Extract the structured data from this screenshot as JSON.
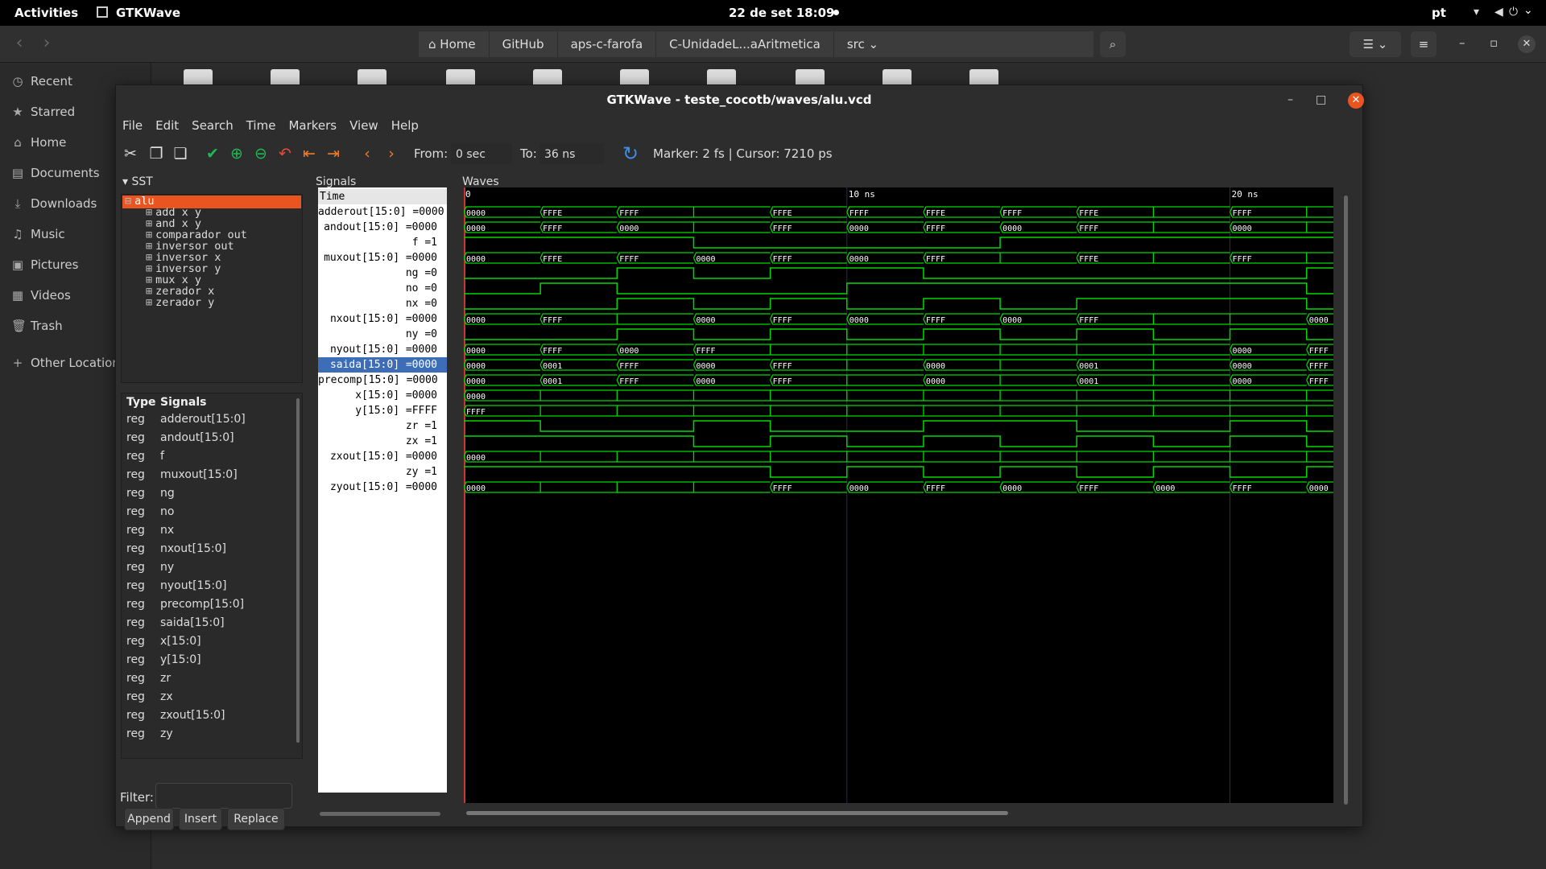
{
  "topbar": {
    "activities": "Activities",
    "app": "GTKWave",
    "clock": "22 de set  18:09",
    "lang": "pt"
  },
  "files": {
    "crumbs": [
      "Home",
      "GitHub",
      "aps-c-farofa",
      "C-UnidadeL...aAritmetica",
      "src"
    ],
    "sidebar": [
      "Recent",
      "Starred",
      "Home",
      "Documents",
      "Downloads",
      "Music",
      "Pictures",
      "Videos",
      "Trash",
      "Other Locations"
    ]
  },
  "window": {
    "title": "GTKWave - teste_cocotb/waves/alu.vcd",
    "menu": [
      "File",
      "Edit",
      "Search",
      "Time",
      "Markers",
      "View",
      "Help"
    ],
    "toolbar": {
      "from_label": "From:",
      "from_value": "0 sec",
      "to_label": "To:",
      "to_value": "36 ns",
      "marker_text": "Marker: 2 fs  |  Cursor: 7210 ps"
    }
  },
  "sst": {
    "title": "SST",
    "root": "alu",
    "children": [
      "add x y",
      "and x y",
      "comparador out",
      "inversor out",
      "inversor x",
      "inversor y",
      "mux x y",
      "zerador x",
      "zerador y"
    ],
    "table_headers": [
      "Type",
      "Signals"
    ],
    "rows": [
      {
        "type": "reg",
        "name": "adderout[15:0]"
      },
      {
        "type": "reg",
        "name": "andout[15:0]"
      },
      {
        "type": "reg",
        "name": "f"
      },
      {
        "type": "reg",
        "name": "muxout[15:0]"
      },
      {
        "type": "reg",
        "name": "ng"
      },
      {
        "type": "reg",
        "name": "no"
      },
      {
        "type": "reg",
        "name": "nx"
      },
      {
        "type": "reg",
        "name": "nxout[15:0]"
      },
      {
        "type": "reg",
        "name": "ny"
      },
      {
        "type": "reg",
        "name": "nyout[15:0]"
      },
      {
        "type": "reg",
        "name": "precomp[15:0]"
      },
      {
        "type": "reg",
        "name": "saida[15:0]"
      },
      {
        "type": "reg",
        "name": "x[15:0]"
      },
      {
        "type": "reg",
        "name": "y[15:0]"
      },
      {
        "type": "reg",
        "name": "zr"
      },
      {
        "type": "reg",
        "name": "zx"
      },
      {
        "type": "reg",
        "name": "zxout[15:0]"
      },
      {
        "type": "reg",
        "name": "zy"
      }
    ],
    "filter_label": "Filter:",
    "buttons": [
      "Append",
      "Insert",
      "Replace"
    ]
  },
  "signals_panel": {
    "title": "Signals",
    "time_label": "Time",
    "selected": 10,
    "rows": [
      "adderout[15:0] =0000",
      "andout[15:0] =0000",
      "f =1",
      "muxout[15:0] =0000",
      "ng =0",
      "no =0",
      "nx =0",
      "nxout[15:0] =0000",
      "ny =0",
      "nyout[15:0] =0000",
      "saida[15:0] =0000",
      "precomp[15:0] =0000",
      "x[15:0] =0000",
      "y[15:0] =FFFF",
      "zr =1",
      "zx =1",
      "zxout[15:0] =0000",
      "zy =1",
      "zyout[15:0] =0000"
    ]
  },
  "waves_panel": {
    "title": "Waves",
    "time_labels": [
      "0",
      "10 ns",
      "20 ns"
    ],
    "time_label_positions_ns": [
      0,
      10,
      20
    ],
    "segment_ns": 2,
    "time_end_ns": 22.7,
    "traces": [
      {
        "kind": "bus",
        "values": [
          "0000",
          "FFFE",
          "FFFF",
          "FFFF",
          "FFFE",
          "FFFF",
          "FFFE",
          "FFFF",
          "FFFE",
          "FFFE",
          "FFFF",
          "FFFF"
        ]
      },
      {
        "kind": "bus",
        "values": [
          "0000",
          "FFFF",
          "0000",
          "0000",
          "FFFF",
          "0000",
          "FFFF",
          "0000",
          "FFFF",
          "FFFF",
          "0000",
          "0000"
        ]
      },
      {
        "kind": "bit",
        "values": [
          1,
          1,
          1,
          0,
          0,
          0,
          0,
          1,
          1,
          1,
          1,
          1
        ]
      },
      {
        "kind": "bus",
        "values": [
          "0000",
          "FFFE",
          "FFFF",
          "0000",
          "FFFF",
          "0000",
          "FFFF",
          "FFFF",
          "FFFE",
          "FFFE",
          "FFFF",
          "FFFF"
        ]
      },
      {
        "kind": "bit",
        "values": [
          0,
          0,
          1,
          0,
          1,
          1,
          0,
          0,
          0,
          0,
          0,
          1
        ]
      },
      {
        "kind": "bit",
        "values": [
          0,
          1,
          0,
          0,
          0,
          1,
          1,
          1,
          1,
          1,
          1,
          0
        ]
      },
      {
        "kind": "bit",
        "values": [
          0,
          0,
          1,
          0,
          1,
          0,
          1,
          0,
          1,
          1,
          1,
          0
        ]
      },
      {
        "kind": "bus",
        "values": [
          "0000",
          "FFFF",
          "FFFF",
          "0000",
          "FFFF",
          "0000",
          "FFFF",
          "0000",
          "FFFF",
          "FFFF",
          "FFFF",
          "0000"
        ]
      },
      {
        "kind": "bit",
        "values": [
          0,
          0,
          1,
          0,
          1,
          0,
          1,
          0,
          1,
          0,
          1,
          0
        ]
      },
      {
        "kind": "bus",
        "values": [
          "0000",
          "FFFF",
          "0000",
          "FFFF",
          "FFFF",
          "FFFF",
          "FFFF",
          "FFFF",
          "FFFF",
          "FFFF",
          "0000",
          "FFFF"
        ]
      },
      {
        "kind": "bus",
        "values": [
          "0000",
          "0001",
          "FFFF",
          "0000",
          "FFFF",
          "FFFF",
          "0000",
          "0000",
          "0001",
          "0001",
          "0000",
          "FFFF"
        ]
      },
      {
        "kind": "bus",
        "values": [
          "0000",
          "0001",
          "FFFF",
          "0000",
          "FFFF",
          "FFFF",
          "0000",
          "0000",
          "0001",
          "0001",
          "0000",
          "FFFF"
        ]
      },
      {
        "kind": "bus",
        "values": [
          "0000",
          "0000",
          "0000",
          "0000",
          "0000",
          "0000",
          "0000",
          "0000",
          "0000",
          "0000",
          "0000",
          "0000"
        ]
      },
      {
        "kind": "bus",
        "values": [
          "FFFF",
          "FFFF",
          "FFFF",
          "FFFF",
          "FFFF",
          "FFFF",
          "FFFF",
          "FFFF",
          "FFFF",
          "FFFF",
          "FFFF",
          "FFFF"
        ]
      },
      {
        "kind": "bit",
        "values": [
          1,
          0,
          0,
          1,
          0,
          0,
          1,
          1,
          0,
          0,
          1,
          0
        ]
      },
      {
        "kind": "bit",
        "values": [
          1,
          1,
          1,
          0,
          1,
          0,
          1,
          0,
          1,
          0,
          1,
          0
        ]
      },
      {
        "kind": "bus",
        "values": [
          "0000",
          "0000",
          "0000",
          "0000",
          "0000",
          "0000",
          "0000",
          "0000",
          "0000",
          "0000",
          "0000",
          "0000"
        ]
      },
      {
        "kind": "bit",
        "values": [
          1,
          1,
          1,
          1,
          0,
          1,
          0,
          1,
          0,
          1,
          0,
          1
        ]
      },
      {
        "kind": "bus",
        "values": [
          "0000",
          "0000",
          "0000",
          "0000",
          "FFFF",
          "0000",
          "FFFF",
          "0000",
          "FFFF",
          "0000",
          "FFFF",
          "0000"
        ]
      }
    ],
    "colors": {
      "trace": "#00d800",
      "grid": "#2a2a5a",
      "marker": "#cc3333",
      "text": "#ffffff"
    }
  }
}
